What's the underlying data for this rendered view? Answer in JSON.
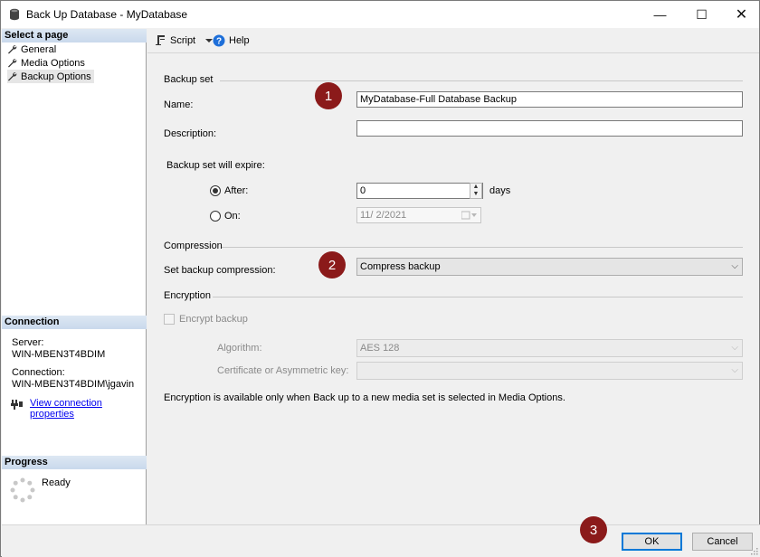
{
  "window": {
    "title": "Back Up Database - MyDatabase",
    "minimize": "—",
    "maximize": "☐",
    "close": "✕"
  },
  "sidebar": {
    "select_page_header": "Select a page",
    "pages": [
      {
        "label": "General"
      },
      {
        "label": "Media Options"
      },
      {
        "label": "Backup Options",
        "selected": true
      }
    ],
    "connection_header": "Connection",
    "server_label": "Server:",
    "server_value": "WIN-MBEN3T4BDIM",
    "connection_label": "Connection:",
    "connection_value": "WIN-MBEN3T4BDIM\\jgavin",
    "view_connection_link": "View connection properties",
    "progress_header": "Progress",
    "progress_status": "Ready"
  },
  "toolbar": {
    "script_label": "Script",
    "help_label": "Help"
  },
  "backup_set": {
    "group_label": "Backup set",
    "name_label": "Name:",
    "name_value": "MyDatabase-Full Database Backup",
    "description_label": "Description:",
    "description_value": "",
    "expire_label": "Backup set will expire:",
    "after_label": "After:",
    "after_value": "0",
    "days_label": "days",
    "on_label": "On:",
    "on_value": "11/  2/2021",
    "expire_mode": "after"
  },
  "compression": {
    "group_label": "Compression",
    "set_label": "Set backup compression:",
    "selected": "Compress backup"
  },
  "encryption": {
    "group_label": "Encryption",
    "encrypt_label": "Encrypt backup",
    "encrypt_checked": false,
    "algorithm_label": "Algorithm:",
    "algorithm_value": "AES 128",
    "certificate_label": "Certificate or Asymmetric key:",
    "certificate_value": "",
    "note": "Encryption is available only when Back up to a new media set is selected in Media Options."
  },
  "annotations": {
    "badge1": "1",
    "badge2": "2",
    "badge3": "3"
  },
  "footer": {
    "ok_label": "OK",
    "cancel_label": "Cancel"
  },
  "colors": {
    "badge": "#8b1a1a",
    "link": "#0000ee",
    "default_button_border": "#0078d7"
  }
}
